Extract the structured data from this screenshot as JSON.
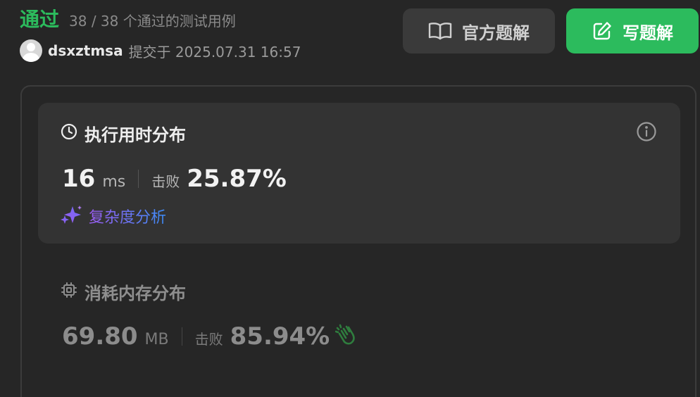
{
  "header": {
    "status": "通过",
    "case_count": "38 / 38 个通过的测试用例",
    "username": "dsxztmsa",
    "submitted_text": "提交于 2025.07.31 16:57"
  },
  "actions": {
    "official_solution": "官方题解",
    "write_solution": "写题解"
  },
  "runtime": {
    "title": "执行用时分布",
    "value": "16",
    "unit": "ms",
    "beat_label": "击败",
    "beat_percent": "25.87%",
    "analysis_link": "复杂度分析"
  },
  "memory": {
    "title": "消耗内存分布",
    "value": "69.80",
    "unit": "MB",
    "beat_label": "击败",
    "beat_percent": "85.94%"
  },
  "icons": {
    "book": "book-open-icon",
    "edit": "edit-icon",
    "clock": "clock-icon",
    "info": "info-icon",
    "sparkle": "sparkle-icon",
    "chip": "chip-icon",
    "clap": "clapping-hands-icon"
  },
  "colors": {
    "background": "#262626",
    "accent_green": "#2cbb5d",
    "panel": "#333333",
    "gradient_start": "#9b5cf0",
    "gradient_end": "#3d8cf7"
  }
}
